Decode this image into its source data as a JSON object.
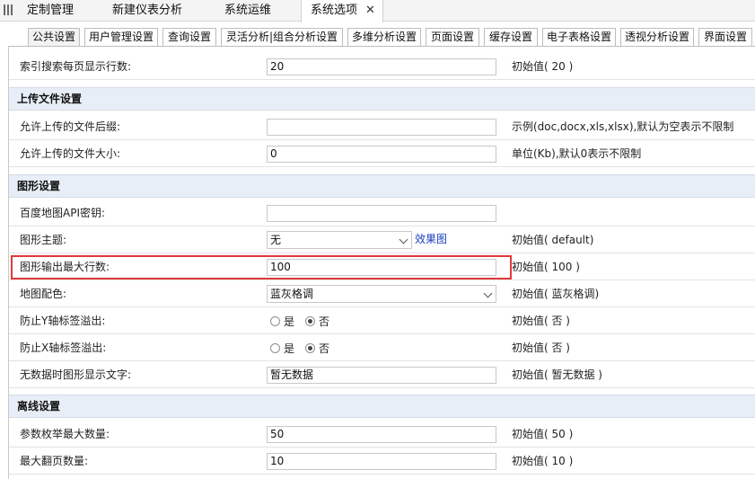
{
  "top_tabs": [
    {
      "label": "定制管理"
    },
    {
      "label": "新建仪表分析"
    },
    {
      "label": "系统运维"
    },
    {
      "label": "系统选项",
      "closable": true
    }
  ],
  "close_glyph": "✕",
  "sub_tabs": [
    "公共设置",
    "用户管理设置",
    "查询设置",
    "灵活分析|组合分析设置",
    "多维分析设置",
    "页面设置",
    "缓存设置",
    "电子表格设置",
    "透视分析设置",
    "界面设置"
  ],
  "rows": {
    "index_search": {
      "label": "索引搜索每页显示行数:",
      "value": "20",
      "note": "初始值( 20 )"
    },
    "upload_section": "上传文件设置",
    "upload_suffix": {
      "label": "允许上传的文件后缀:",
      "value": "",
      "note": "示例(doc,docx,xls,xlsx),默认为空表示不限制"
    },
    "upload_size": {
      "label": "允许上传的文件大小:",
      "value": "0",
      "note": "单位(Kb),默认0表示不限制"
    },
    "graph_section": "图形设置",
    "baidu_key": {
      "label": "百度地图API密钥:",
      "value": ""
    },
    "graph_theme": {
      "label": "图形主题:",
      "value": "无",
      "link": "效果图",
      "note": "初始值( default)"
    },
    "graph_max_rows": {
      "label": "图形输出最大行数:",
      "value": "100",
      "note": "初始值( 100 )"
    },
    "map_color": {
      "label": "地图配色:",
      "value": "蓝灰格调",
      "note": "初始值( 蓝灰格调)"
    },
    "y_overflow": {
      "label": "防止Y轴标签溢出:",
      "opt_yes": "是",
      "opt_no": "否",
      "note": "初始值( 否 )"
    },
    "x_overflow": {
      "label": "防止X轴标签溢出:",
      "opt_yes": "是",
      "opt_no": "否",
      "note": "初始值( 否 )"
    },
    "no_data_text": {
      "label": "无数据时图形显示文字:",
      "value": "暂无数据",
      "note": "初始值( 暂无数据 )"
    },
    "offline_section": "离线设置",
    "param_enum_max": {
      "label": "参数枚举最大数量:",
      "value": "50",
      "note": "初始值( 50 )"
    },
    "max_page_count": {
      "label": "最大翻页数量:",
      "value": "10",
      "note": "初始值( 10 )"
    }
  },
  "colors": {
    "highlight": "#e3393b",
    "section_bg": "#e7eef7",
    "link": "#1a3fbf"
  }
}
